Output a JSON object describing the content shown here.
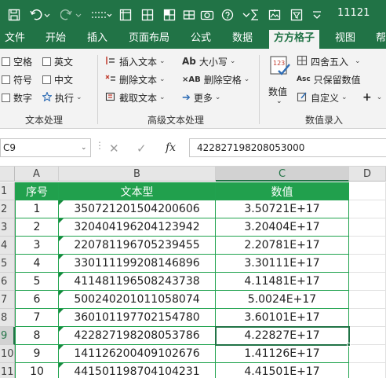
{
  "title_bar": {
    "doc_title": "11121",
    "icons": [
      "save-icon",
      "undo-icon",
      "redo-icon",
      "text-tool-icon",
      "grid-tool-icon",
      "table-tool-icon",
      "cell-tool-icon",
      "camera-icon",
      "help-icon",
      "formula-icon",
      "image-icon",
      "menu-icon"
    ]
  },
  "tabs": [
    {
      "label": "文件"
    },
    {
      "label": "开始"
    },
    {
      "label": "插入"
    },
    {
      "label": "页面布局"
    },
    {
      "label": "公式"
    },
    {
      "label": "数据"
    },
    {
      "label": "方方格子",
      "active": true
    },
    {
      "label": "视图"
    },
    {
      "label": "帮"
    }
  ],
  "ribbon": {
    "text_processing": {
      "group_label": "文本处理",
      "items": [
        {
          "label": "空格",
          "icon": "checkbox-icon"
        },
        {
          "label": "英文",
          "icon": "checkbox-icon"
        },
        {
          "label": "符号",
          "icon": "checkbox-icon"
        },
        {
          "label": "中文",
          "icon": "checkbox-icon"
        },
        {
          "label": "数字",
          "icon": "checkbox-icon"
        },
        {
          "label": "执行",
          "icon": "execute-icon"
        }
      ]
    },
    "advanced_text": {
      "group_label": "高级文本处理",
      "items": [
        {
          "label": "插入文本",
          "icon": "insert-text-icon"
        },
        {
          "label": "删除文本",
          "icon": "delete-text-icon"
        },
        {
          "label": "截取文本",
          "icon": "extract-text-icon"
        },
        {
          "label": "大小写",
          "icon": "case-icon"
        },
        {
          "label": "删除空格",
          "icon": "delete-space-icon"
        },
        {
          "label": "更多",
          "icon": "arrow-right-icon"
        }
      ]
    },
    "number_entry": {
      "group_label": "数值录入",
      "items": [
        {
          "label": "数值",
          "icon": "number-icon"
        },
        {
          "label": "四舍五入",
          "icon": "round-icon"
        },
        {
          "label": "只保留数值",
          "icon": "keep-values-icon"
        },
        {
          "label": "自定义",
          "icon": "custom-icon"
        },
        {
          "label": "+",
          "icon": "plus-icon"
        }
      ]
    }
  },
  "formula_bar": {
    "name_box": "C9",
    "formula": "422827198208053000",
    "fx_label": "fx"
  },
  "accent_color": "#217346",
  "header_fill": "#21a04d",
  "sheet": {
    "columns": [
      "A",
      "B",
      "C",
      "D"
    ],
    "rows": [
      "1",
      "2",
      "3",
      "4",
      "5",
      "6",
      "7",
      "8",
      "9",
      "10",
      "11"
    ],
    "header": [
      "序号",
      "文本型",
      "数值"
    ],
    "data": [
      [
        "1",
        "350721201504200606",
        "3.50721E+17"
      ],
      [
        "2",
        "320404196204123942",
        "3.20404E+17"
      ],
      [
        "3",
        "220781196705239455",
        "2.20781E+17"
      ],
      [
        "4",
        "330111199208146896",
        "3.30111E+17"
      ],
      [
        "5",
        "411481196508243738",
        "4.11481E+17"
      ],
      [
        "6",
        "500240201011058074",
        "5.0024E+17"
      ],
      [
        "7",
        "360101197702154780",
        "3.60101E+17"
      ],
      [
        "8",
        "422827198208053786",
        "4.22827E+17"
      ],
      [
        "9",
        "141126200409102676",
        "1.41126E+17"
      ],
      [
        "10",
        "441501198704104231",
        "4.41501E+17"
      ]
    ],
    "selected_cell": "C9"
  }
}
